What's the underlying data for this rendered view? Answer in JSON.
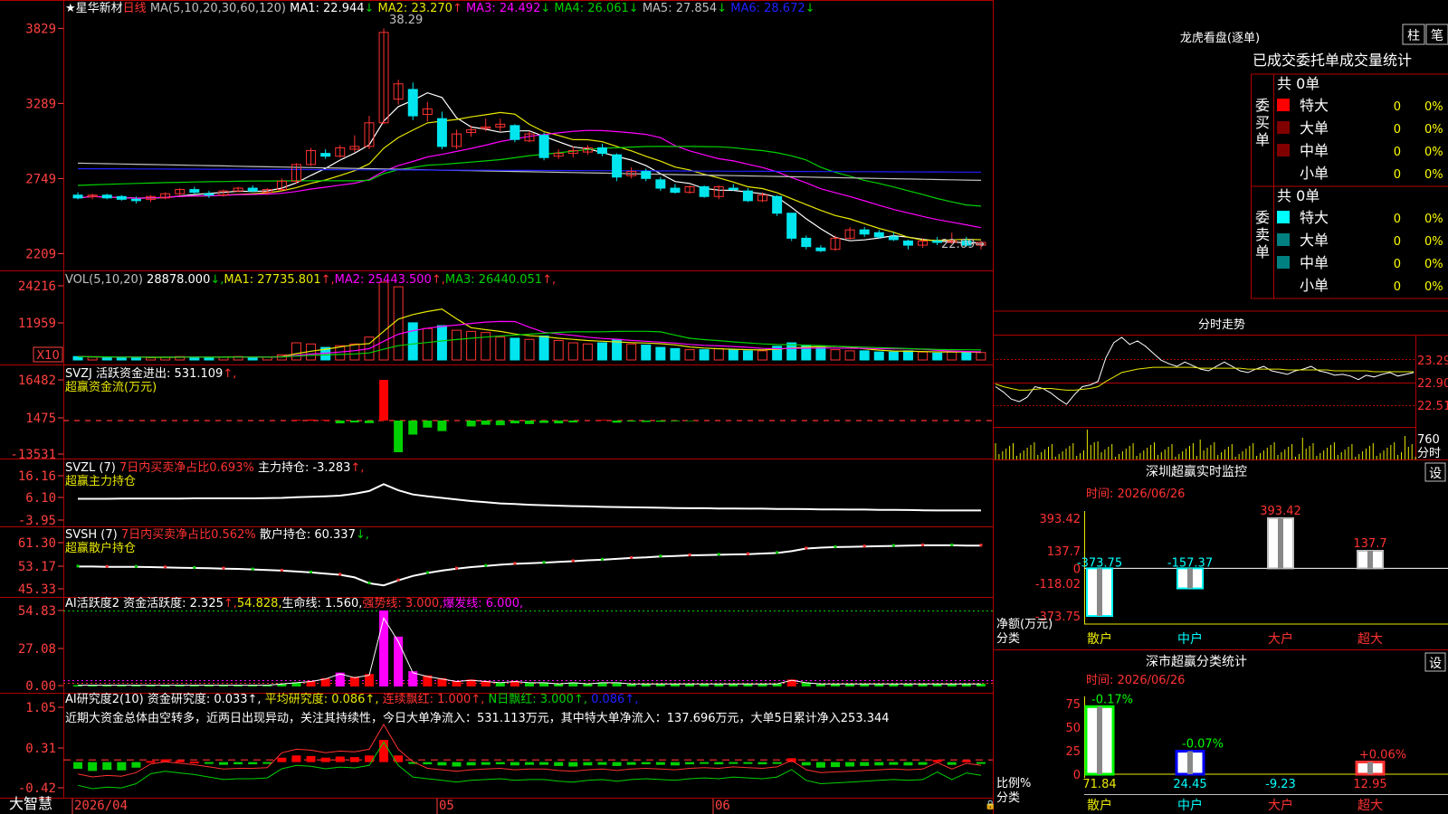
{
  "app": {
    "brand": "大智慧"
  },
  "colors": {
    "up": "#ff3232",
    "down": "#00e5ee",
    "grid": "#b00000",
    "ma1": "#ffffff",
    "ma2": "#e8e800",
    "ma3": "#ff00ff",
    "ma4": "#00d000",
    "ma5": "#c0c0c0",
    "ma6": "#2020ff",
    "vol": "#00e5ee",
    "axisText": "#ff4040"
  },
  "main": {
    "stock_name": "星华新材",
    "period": "日线",
    "ma_header": "MA(5,10,20,30,60,120)",
    "ma_items": [
      {
        "label": "MA1: 22.944",
        "arrow": "↓",
        "color": "#ffffff"
      },
      {
        "label": "MA2: 23.270",
        "arrow": "↑",
        "color": "#e8e800"
      },
      {
        "label": "MA3: 24.492",
        "arrow": "↓",
        "color": "#ff00ff"
      },
      {
        "label": "MA4: 26.061",
        "arrow": "↓",
        "color": "#00d000"
      },
      {
        "label": "MA5: 27.854",
        "arrow": "↓",
        "color": "#c0c0c0"
      },
      {
        "label": "MA6: 28.672",
        "arrow": "↓",
        "color": "#2020ff"
      }
    ],
    "high_label": "38.29",
    "low_label": "22.09",
    "y_ticks": [
      "3829",
      "3289",
      "2749",
      "2209"
    ]
  },
  "vol": {
    "header": "VOL(5,10,20)",
    "value": "28878.000",
    "value_arrow": "↓",
    "items": [
      {
        "label": "MA1: 27735.801",
        "arrow": "↑",
        "color": "#e8e800"
      },
      {
        "label": "MA2: 25443.500",
        "arrow": "↑",
        "color": "#ff00ff"
      },
      {
        "label": "MA3: 26440.051",
        "arrow": "↑",
        "color": "#00d000"
      }
    ],
    "y_ticks": [
      "24216",
      "11959"
    ],
    "unit": "X10"
  },
  "svzj": {
    "header": "SVZJ  活跃资金进出: 531.109",
    "arrow": "↑",
    "sub": "超赢资金流(万元)",
    "y_ticks": [
      "16482",
      "1475",
      "-13531"
    ]
  },
  "svzl": {
    "header": "SVZL (7)",
    "red_part": "7日内买卖净占比0.693%",
    "rest": " 主力持仓: -3.283",
    "arrow": "↑",
    "sub": "超赢主力持仓",
    "y_ticks": [
      "16.16",
      "6.10",
      "-3.95"
    ]
  },
  "svsh": {
    "header": "SVSH (7)",
    "red_part": "7日内买卖净占比0.562%",
    "rest": " 散户持仓: 60.337",
    "arrow": "↓",
    "sub": "超赢散户持仓",
    "y_ticks": [
      "61.30",
      "53.17",
      "45.33"
    ]
  },
  "ai1": {
    "header": "AI活跃度2 资金活跃度: 2.325",
    "arrow": "↑",
    "items": [
      {
        "label": "54.828",
        "color": "#e8e800"
      },
      {
        "label": "生命线: 1.560",
        "color": "#ffffff"
      },
      {
        "label": "强势线: 3.000",
        "color": "#ff3232"
      },
      {
        "label": "爆发线: 6.000",
        "color": "#ff00ff"
      }
    ],
    "y_ticks": [
      "54.83",
      "27.08",
      "0.00"
    ]
  },
  "ai2": {
    "header": "AI研究度2(10) 资金研究度: 0.033",
    "items": [
      {
        "label": "平均研究度: 0.086",
        "color": "#e8e800"
      },
      {
        "label": "连续飘红: 1.000",
        "color": "#ff3232"
      },
      {
        "label": "N日飘红: 3.000",
        "color": "#00d000"
      },
      {
        "label": "0.086",
        "color": "#2020ff"
      }
    ],
    "comment": "近期大资金总体由空转多，近两日出现异动，关注其持续性，今日大单净流入：531.113万元，其中特大单净流入：137.696万元，大单5日累计净入253.344",
    "y_ticks": [
      "1.05",
      "0.31",
      "-0.42"
    ]
  },
  "xaxis": {
    "labels": [
      "2026/04",
      "05",
      "06"
    ]
  },
  "lhb": {
    "title": "龙虎看盘(逐单)",
    "btn1": "柱",
    "btn2": "笔",
    "subtitle": "已成交委托单成交量统计",
    "buy": {
      "side": "委买单",
      "total": "共 0单",
      "rows": [
        {
          "name": "特大",
          "v": "0",
          "p": "0%",
          "color": "#ff0000"
        },
        {
          "name": "大单",
          "v": "0",
          "p": "0%",
          "color": "#800000"
        },
        {
          "name": "中单",
          "v": "0",
          "p": "0%",
          "color": "#800000"
        },
        {
          "name": "小单",
          "v": "0",
          "p": "0%",
          "color": ""
        }
      ]
    },
    "sell": {
      "side": "委卖单",
      "total": "共 0单",
      "rows": [
        {
          "name": "特大",
          "v": "0",
          "p": "0%",
          "color": "#00ffff"
        },
        {
          "name": "大单",
          "v": "0",
          "p": "0%",
          "color": "#008080"
        },
        {
          "name": "中单",
          "v": "0",
          "p": "0%",
          "color": "#008080"
        },
        {
          "name": "小单",
          "v": "0",
          "p": "0%",
          "color": ""
        }
      ]
    }
  },
  "fenshi": {
    "title": "分时走势",
    "y_ticks": [
      "23.29",
      "22.90",
      "22.51"
    ],
    "vol_label": "760",
    "vol_sub": "分时"
  },
  "monitor": {
    "title": "深圳超赢实时监控",
    "btn": "设",
    "time": "时间: 2026/06/26",
    "y_ticks": [
      "393.42",
      "137.7",
      "0",
      "-118.02",
      "-373.75"
    ],
    "ylabel": "净额(万元)",
    "xlabel": "分类"
  },
  "classify": {
    "title": "深市超赢分类统计",
    "btn": "设",
    "time": "时间: 2026/06/26",
    "y_ticks": [
      "75",
      "50",
      "25",
      "0"
    ],
    "ylabel": "比例%",
    "xlabel": "分类"
  },
  "chart_data": [
    {
      "type": "candlestick",
      "name": "星华新材 日线",
      "ohlc": [
        [
          26.3,
          26.5,
          26.0,
          26.1
        ],
        [
          26.2,
          26.4,
          26.0,
          26.3
        ],
        [
          26.3,
          26.4,
          26.0,
          26.1
        ],
        [
          26.2,
          26.3,
          25.9,
          26.0
        ],
        [
          26.0,
          26.2,
          25.7,
          25.9
        ],
        [
          26.0,
          26.3,
          25.8,
          26.2
        ],
        [
          26.1,
          26.5,
          26.0,
          26.4
        ],
        [
          26.4,
          26.8,
          26.3,
          26.7
        ],
        [
          26.7,
          26.9,
          26.4,
          26.5
        ],
        [
          26.4,
          26.6,
          26.1,
          26.3
        ],
        [
          26.3,
          26.7,
          26.2,
          26.6
        ],
        [
          26.6,
          26.9,
          26.5,
          26.8
        ],
        [
          26.8,
          27.0,
          26.5,
          26.6
        ],
        [
          26.5,
          26.8,
          26.3,
          26.7
        ],
        [
          26.7,
          27.5,
          26.6,
          27.3
        ],
        [
          27.3,
          28.6,
          27.1,
          28.5
        ],
        [
          28.5,
          29.7,
          28.4,
          29.5
        ],
        [
          29.3,
          29.6,
          28.9,
          29.1
        ],
        [
          29.1,
          29.9,
          29.0,
          29.7
        ],
        [
          29.6,
          30.6,
          29.4,
          29.8
        ],
        [
          29.8,
          32.0,
          29.6,
          31.5
        ],
        [
          31.5,
          38.29,
          31.4,
          38.0
        ],
        [
          33.2,
          34.6,
          32.8,
          34.3
        ],
        [
          33.9,
          34.4,
          31.7,
          32.0
        ],
        [
          32.1,
          33.0,
          31.6,
          32.5
        ],
        [
          31.8,
          32.3,
          29.6,
          29.8
        ],
        [
          29.8,
          31.0,
          29.6,
          30.7
        ],
        [
          30.8,
          31.3,
          30.5,
          31.0
        ],
        [
          31.1,
          31.8,
          30.9,
          31.2
        ],
        [
          31.2,
          31.8,
          30.9,
          31.4
        ],
        [
          31.3,
          31.4,
          30.1,
          30.3
        ],
        [
          30.2,
          30.9,
          30.1,
          30.7
        ],
        [
          30.6,
          30.8,
          28.8,
          29.0
        ],
        [
          29.1,
          29.6,
          28.9,
          29.3
        ],
        [
          29.3,
          29.8,
          29.0,
          29.5
        ],
        [
          29.4,
          29.9,
          29.2,
          29.7
        ],
        [
          29.7,
          30.0,
          29.1,
          29.3
        ],
        [
          29.2,
          29.3,
          27.3,
          27.6
        ],
        [
          27.7,
          28.3,
          27.5,
          28.0
        ],
        [
          28.0,
          28.2,
          27.3,
          27.5
        ],
        [
          27.4,
          27.6,
          26.6,
          26.8
        ],
        [
          26.8,
          27.1,
          26.4,
          26.5
        ],
        [
          26.5,
          27.0,
          26.4,
          26.9
        ],
        [
          26.9,
          27.0,
          26.1,
          26.2
        ],
        [
          26.2,
          27.0,
          26.0,
          26.9
        ],
        [
          26.8,
          27.1,
          26.6,
          26.7
        ],
        [
          26.6,
          26.8,
          25.8,
          25.9
        ],
        [
          25.9,
          26.5,
          25.8,
          26.3
        ],
        [
          26.2,
          26.3,
          24.8,
          25.0
        ],
        [
          25.0,
          25.0,
          23.0,
          23.2
        ],
        [
          23.2,
          23.4,
          22.4,
          22.6
        ],
        [
          22.5,
          22.7,
          22.2,
          22.3
        ],
        [
          22.4,
          23.4,
          22.3,
          23.2
        ],
        [
          23.2,
          24.0,
          23.1,
          23.8
        ],
        [
          23.8,
          24.0,
          23.3,
          23.5
        ],
        [
          23.6,
          23.8,
          23.2,
          23.3
        ],
        [
          23.3,
          23.6,
          23.0,
          23.1
        ],
        [
          23.0,
          23.1,
          22.4,
          22.7
        ],
        [
          22.7,
          23.2,
          22.5,
          23.0
        ],
        [
          23.0,
          23.3,
          22.7,
          22.9
        ],
        [
          22.9,
          23.6,
          22.8,
          23.0
        ],
        [
          23.0,
          23.3,
          22.6,
          22.7
        ],
        [
          22.7,
          23.0,
          22.4,
          22.9
        ]
      ],
      "high_label": "38.29",
      "low_label": "22.09"
    },
    {
      "type": "bar",
      "name": "VOL",
      "values": [
        6,
        5,
        5,
        4,
        5,
        4,
        5,
        6,
        5,
        4,
        5,
        6,
        5,
        5,
        9,
        30,
        28,
        22,
        25,
        28,
        40,
        136,
        128,
        65,
        55,
        60,
        52,
        50,
        48,
        40,
        38,
        36,
        42,
        34,
        30,
        28,
        30,
        36,
        28,
        26,
        22,
        20,
        18,
        18,
        20,
        18,
        16,
        16,
        24,
        30,
        26,
        22,
        18,
        16,
        16,
        14,
        14,
        16,
        14,
        12,
        14,
        14,
        13
      ]
    },
    {
      "type": "bar",
      "name": "SVZJ",
      "values": [
        0,
        0,
        0,
        0,
        0,
        0,
        0,
        0,
        0,
        0,
        0,
        0,
        0,
        0,
        0,
        300,
        400,
        300,
        -1200,
        -800,
        -1100,
        16482,
        -13531,
        -6000,
        -3000,
        -4500,
        0,
        -2500,
        -1800,
        -2000,
        -1200,
        -1500,
        -1000,
        -1200,
        -800,
        0,
        300,
        -900,
        -400,
        -600,
        -500,
        -300,
        -200,
        0,
        0,
        0,
        0,
        0,
        0,
        0,
        0,
        0,
        0,
        0,
        0,
        0,
        0,
        0,
        0,
        0,
        0,
        0,
        0
      ]
    },
    {
      "type": "line",
      "name": "SVZL",
      "values": [
        6.1,
        6.1,
        6.1,
        6.2,
        6.2,
        6.2,
        6.2,
        6.2,
        6.3,
        6.3,
        6.3,
        6.3,
        6.3,
        6.4,
        6.5,
        6.8,
        7.0,
        7.2,
        7.5,
        8.3,
        9.5,
        12.5,
        9.8,
        8.0,
        7.2,
        6.5,
        5.8,
        5.1,
        4.6,
        4.1,
        3.8,
        3.5,
        3.3,
        3.1,
        2.9,
        2.8,
        2.6,
        2.5,
        2.4,
        2.3,
        2.2,
        2.1,
        2.0,
        2.0,
        1.9,
        1.9,
        1.8,
        1.8,
        1.7,
        1.7,
        1.6,
        1.5,
        1.5,
        1.4,
        1.4,
        1.3,
        1.3,
        1.2,
        1.1,
        1.0,
        1.0,
        1.0,
        1.0
      ]
    },
    {
      "type": "line",
      "name": "SVSH",
      "values": [
        53.2,
        53.2,
        53.1,
        53.1,
        53.1,
        53.0,
        52.9,
        52.8,
        52.7,
        52.6,
        52.5,
        52.4,
        52.2,
        52.0,
        51.8,
        51.5,
        51.2,
        50.8,
        50.4,
        49.5,
        47.5,
        46.8,
        48.5,
        50.0,
        51.0,
        51.8,
        52.5,
        53.0,
        53.4,
        53.8,
        54.1,
        54.3,
        54.5,
        54.8,
        55.0,
        55.3,
        55.5,
        55.8,
        56.1,
        56.3,
        56.6,
        56.8,
        57.0,
        57.1,
        57.2,
        57.3,
        57.4,
        57.6,
        57.8,
        58.4,
        59.3,
        59.6,
        59.8,
        59.9,
        60.0,
        60.1,
        60.2,
        60.3,
        60.4,
        60.4,
        60.4,
        60.3,
        60.3
      ]
    },
    {
      "type": "bar",
      "name": "AI活跃度2",
      "values": [
        1,
        1,
        1,
        1,
        1,
        1,
        1,
        1,
        1,
        1,
        1,
        1,
        1,
        1,
        2,
        3,
        4,
        6,
        10,
        7,
        9,
        54.83,
        36,
        11,
        8,
        6,
        4,
        5,
        4,
        3,
        4,
        3,
        3,
        2,
        3,
        2,
        3,
        3,
        2,
        2,
        2,
        2,
        2,
        2,
        2,
        2,
        2,
        2,
        2,
        5,
        3,
        2,
        2,
        2,
        2,
        2,
        2,
        2,
        2,
        2,
        2,
        2,
        2
      ]
    },
    {
      "type": "bar",
      "name": "AI研究度2",
      "values": [
        -0.12,
        -0.16,
        -0.14,
        -0.15,
        -0.1,
        0.02,
        0.05,
        0.03,
        0.01,
        -0.02,
        -0.05,
        -0.04,
        -0.04,
        -0.03,
        0.08,
        0.12,
        0.11,
        0.08,
        0.1,
        0.09,
        0.12,
        0.4,
        0.12,
        -0.02,
        -0.04,
        -0.06,
        -0.08,
        -0.06,
        -0.05,
        -0.04,
        -0.06,
        -0.05,
        -0.05,
        -0.07,
        -0.08,
        -0.06,
        -0.05,
        -0.07,
        -0.05,
        -0.04,
        -0.05,
        -0.06,
        -0.04,
        -0.03,
        -0.04,
        -0.02,
        -0.03,
        -0.04,
        -0.02,
        0.07,
        -0.06,
        -0.1,
        -0.09,
        -0.08,
        -0.07,
        -0.06,
        -0.05,
        -0.06,
        -0.05,
        0.04,
        -0.05,
        0.03,
        0.0
      ]
    },
    {
      "type": "line",
      "name": "分时走势",
      "prev_close": 22.9,
      "price": [
        22.72,
        22.66,
        22.58,
        22.55,
        22.6,
        22.72,
        22.7,
        22.65,
        22.58,
        22.52,
        22.63,
        22.72,
        22.74,
        22.78,
        23.05,
        23.22,
        23.28,
        23.2,
        23.24,
        23.18,
        23.1,
        23.02,
        22.98,
        22.95,
        23.0,
        22.96,
        22.92,
        22.9,
        22.95,
        23.0,
        22.95,
        22.9,
        22.88,
        22.92,
        22.95,
        22.9,
        22.88,
        22.86,
        22.9,
        22.92,
        22.95,
        22.9,
        22.88,
        22.85,
        22.86,
        22.84,
        22.8,
        22.85,
        22.83,
        22.86,
        22.88,
        22.84,
        22.86,
        22.88
      ],
      "avg": [
        22.75,
        22.72,
        22.7,
        22.68,
        22.68,
        22.69,
        22.7,
        22.7,
        22.69,
        22.68,
        22.68,
        22.69,
        22.7,
        22.72,
        22.78,
        22.83,
        22.88,
        22.9,
        22.92,
        22.93,
        22.94,
        22.94,
        22.94,
        22.94,
        22.94,
        22.94,
        22.93,
        22.93,
        22.93,
        22.93,
        22.93,
        22.93,
        22.92,
        22.92,
        22.92,
        22.92,
        22.92,
        22.91,
        22.91,
        22.91,
        22.91,
        22.91,
        22.91,
        22.9,
        22.9,
        22.9,
        22.9,
        22.9,
        22.89,
        22.89,
        22.89,
        22.89,
        22.89,
        22.89
      ]
    },
    {
      "type": "bar",
      "name": "深圳超赢实时监控",
      "categories": [
        "散户",
        "中户",
        "大户",
        "超大"
      ],
      "values": [
        -373.75,
        -157.37,
        393.42,
        137.7
      ],
      "ylim": [
        -373.75,
        393.42
      ]
    },
    {
      "type": "bar",
      "name": "深市超赢分类统计",
      "categories": [
        "散户",
        "中户",
        "大户",
        "超大"
      ],
      "values": [
        71.84,
        24.45,
        -9.23,
        12.95
      ],
      "changes": [
        "-0.17%",
        "-0.07%",
        "",
        "+0.06%"
      ],
      "ylim": [
        0,
        75
      ]
    }
  ]
}
